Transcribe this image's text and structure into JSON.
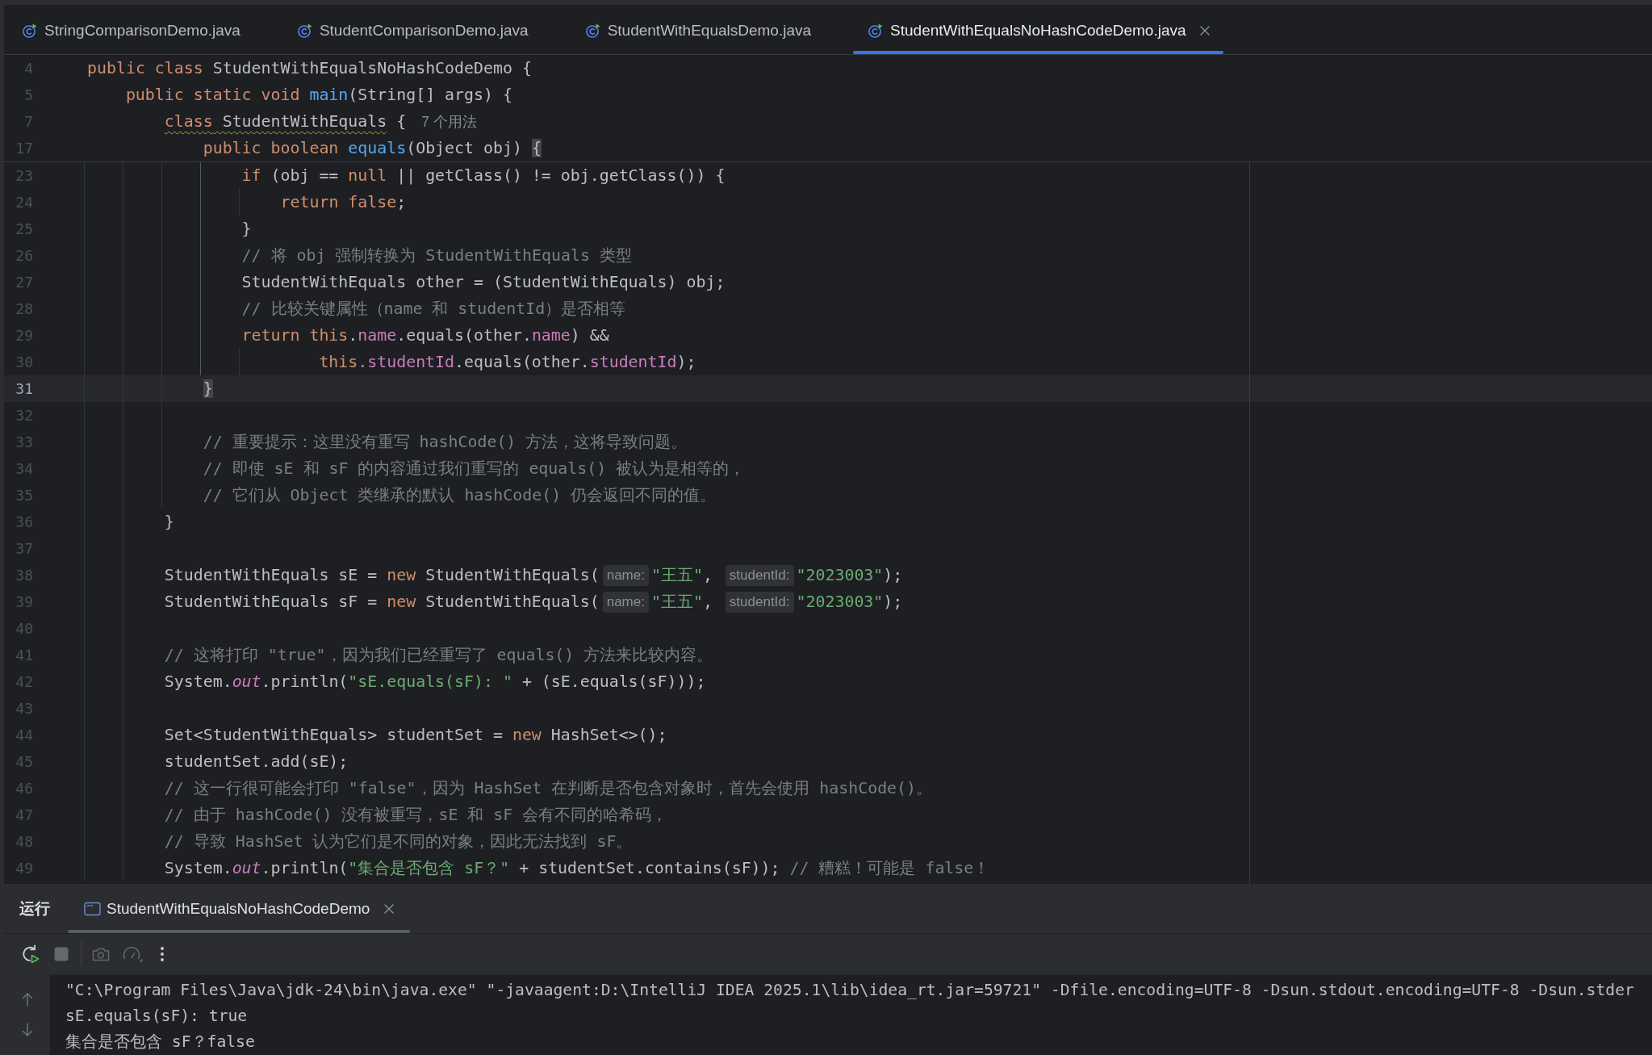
{
  "editor_tabs": [
    {
      "label": "StringComparisonDemo.java",
      "selected": false
    },
    {
      "label": "StudentComparisonDemo.java",
      "selected": false
    },
    {
      "label": "StudentWithEqualsDemo.java",
      "selected": false
    },
    {
      "label": "StudentWithEqualsNoHashCodeDemo.java",
      "selected": true
    }
  ],
  "editor": {
    "sticky_lines": [
      {
        "number": "4",
        "tokens": [
          {
            "kind": "keyword",
            "text": "public class"
          },
          {
            "kind": "plain",
            "text": " StudentWithEqualsNoHashCodeDemo {"
          }
        ]
      },
      {
        "number": "5",
        "tokens": [
          {
            "kind": "keyword",
            "text": "    public static void "
          },
          {
            "kind": "method",
            "text": "main"
          },
          {
            "kind": "plain",
            "text": "(String[] args) {"
          }
        ]
      },
      {
        "number": "7",
        "tokens": [
          {
            "kind": "warning",
            "tokens": [
              {
                "kind": "keyword",
                "text": "        class"
              },
              {
                "kind": "plain",
                "text": " StudentWithEquals"
              }
            ]
          },
          {
            "kind": "plain",
            "text": " {"
          },
          {
            "kind": "usage_hint",
            "text": "7 个用法"
          }
        ]
      },
      {
        "number": "17",
        "tokens": [
          {
            "kind": "keyword",
            "text": "            public boolean "
          },
          {
            "kind": "method",
            "text": "equals"
          },
          {
            "kind": "plain",
            "text": "(Object obj) "
          },
          {
            "kind": "brace_match",
            "text": "{"
          }
        ]
      }
    ],
    "lines": [
      {
        "number": "23",
        "current": false,
        "tokens": [
          {
            "kind": "keyword",
            "text": "                if"
          },
          {
            "kind": "plain",
            "text": " (obj == "
          },
          {
            "kind": "keyword",
            "text": "null"
          },
          {
            "kind": "plain",
            "text": " || getClass() != obj.getClass()) {"
          }
        ]
      },
      {
        "number": "24",
        "current": false,
        "tokens": [
          {
            "kind": "keyword",
            "text": "                    return false"
          },
          {
            "kind": "plain",
            "text": ";"
          }
        ]
      },
      {
        "number": "25",
        "current": false,
        "tokens": [
          {
            "kind": "plain",
            "text": "                }"
          }
        ]
      },
      {
        "number": "26",
        "current": false,
        "tokens": [
          {
            "kind": "comment",
            "text": "                // 将 obj 强制转换为 StudentWithEquals 类型"
          }
        ]
      },
      {
        "number": "27",
        "current": false,
        "tokens": [
          {
            "kind": "plain",
            "text": "                StudentWithEquals other = (StudentWithEquals) obj;"
          }
        ]
      },
      {
        "number": "28",
        "current": false,
        "tokens": [
          {
            "kind": "comment",
            "text": "                // 比较关键属性（name 和 studentId）是否相等"
          }
        ]
      },
      {
        "number": "29",
        "current": false,
        "tokens": [
          {
            "kind": "keyword",
            "text": "                return this"
          },
          {
            "kind": "plain",
            "text": "."
          },
          {
            "kind": "field",
            "text": "name"
          },
          {
            "kind": "plain",
            "text": ".equals(other."
          },
          {
            "kind": "field",
            "text": "name"
          },
          {
            "kind": "plain",
            "text": ") &&"
          }
        ]
      },
      {
        "number": "30",
        "current": false,
        "tokens": [
          {
            "kind": "keyword",
            "text": "                        this"
          },
          {
            "kind": "field",
            "text": ".studentId"
          },
          {
            "kind": "plain",
            "text": ".equals(other."
          },
          {
            "kind": "field",
            "text": "studentId"
          },
          {
            "kind": "plain",
            "text": ");"
          }
        ]
      },
      {
        "number": "31",
        "current": true,
        "tokens": [
          {
            "kind": "brace_match",
            "text": "            }"
          }
        ]
      },
      {
        "number": "32",
        "current": false
      },
      {
        "number": "33",
        "current": false,
        "tokens": [
          {
            "kind": "comment",
            "text": "            // 重要提示：这里没有重写 hashCode() 方法，这将导致问题。"
          }
        ]
      },
      {
        "number": "34",
        "current": false,
        "tokens": [
          {
            "kind": "comment",
            "text": "            // 即使 sE 和 sF 的内容通过我们重写的 equals() 被认为是相等的，"
          }
        ]
      },
      {
        "number": "35",
        "current": false,
        "tokens": [
          {
            "kind": "comment",
            "text": "            // 它们从 Object 类继承的默认 hashCode() 仍会返回不同的值。"
          }
        ]
      },
      {
        "number": "36",
        "current": false,
        "tokens": [
          {
            "kind": "plain",
            "text": "        }"
          }
        ]
      },
      {
        "number": "37",
        "current": false
      },
      {
        "number": "38",
        "current": false,
        "tokens": [
          {
            "kind": "plain",
            "text": "        StudentWithEquals sE = "
          },
          {
            "kind": "keyword",
            "text": "new"
          },
          {
            "kind": "plain",
            "text": " StudentWithEquals("
          },
          {
            "kind": "param_hint",
            "text": "name:"
          },
          {
            "kind": "string",
            "text": "\"王五\""
          },
          {
            "kind": "plain",
            "text": ", "
          },
          {
            "kind": "param_hint",
            "text": "studentId:"
          },
          {
            "kind": "string",
            "text": "\"2023003\""
          },
          {
            "kind": "plain",
            "text": ");"
          }
        ]
      },
      {
        "number": "39",
        "current": false,
        "tokens": [
          {
            "kind": "plain",
            "text": "        StudentWithEquals sF = "
          },
          {
            "kind": "keyword",
            "text": "new"
          },
          {
            "kind": "plain",
            "text": " StudentWithEquals("
          },
          {
            "kind": "param_hint",
            "text": "name:"
          },
          {
            "kind": "string",
            "text": "\"王五\""
          },
          {
            "kind": "plain",
            "text": ", "
          },
          {
            "kind": "param_hint",
            "text": "studentId:"
          },
          {
            "kind": "string",
            "text": "\"2023003\""
          },
          {
            "kind": "plain",
            "text": ");"
          }
        ]
      },
      {
        "number": "40",
        "current": false
      },
      {
        "number": "41",
        "current": false,
        "tokens": [
          {
            "kind": "comment",
            "text": "        // 这将打印 \"true\"，因为我们已经重写了 equals() 方法来比较内容。"
          }
        ]
      },
      {
        "number": "42",
        "current": false,
        "tokens": [
          {
            "kind": "plain",
            "text": "        System."
          },
          {
            "kind": "static_field",
            "text": "out"
          },
          {
            "kind": "plain",
            "text": ".println("
          },
          {
            "kind": "string",
            "text": "\"sE.equals(sF): \""
          },
          {
            "kind": "plain",
            "text": " + (sE.equals(sF)));"
          }
        ]
      },
      {
        "number": "43",
        "current": false
      },
      {
        "number": "44",
        "current": false,
        "tokens": [
          {
            "kind": "plain",
            "text": "        Set<StudentWithEquals> studentSet = "
          },
          {
            "kind": "keyword",
            "text": "new"
          },
          {
            "kind": "plain",
            "text": " HashSet<>();"
          }
        ]
      },
      {
        "number": "45",
        "current": false,
        "tokens": [
          {
            "kind": "plain",
            "text": "        studentSet.add(sE);"
          }
        ]
      },
      {
        "number": "46",
        "current": false,
        "tokens": [
          {
            "kind": "comment",
            "text": "        // 这一行很可能会打印 \"false\"，因为 HashSet 在判断是否包含对象时，首先会使用 hashCode()。"
          }
        ]
      },
      {
        "number": "47",
        "current": false,
        "tokens": [
          {
            "kind": "comment",
            "text": "        // 由于 hashCode() 没有被重写，sE 和 sF 会有不同的哈希码，"
          }
        ]
      },
      {
        "number": "48",
        "current": false,
        "tokens": [
          {
            "kind": "comment",
            "text": "        // 导致 HashSet 认为它们是不同的对象，因此无法找到 sF。"
          }
        ]
      },
      {
        "number": "49",
        "current": false,
        "tokens": [
          {
            "kind": "plain",
            "text": "        System."
          },
          {
            "kind": "static_field",
            "text": "out"
          },
          {
            "kind": "plain",
            "text": ".println("
          },
          {
            "kind": "string",
            "text": "\"集合是否包含 sF？\""
          },
          {
            "kind": "plain",
            "text": " + studentSet.contains(sF)); "
          },
          {
            "kind": "comment",
            "text": "// 糟糕！可能是 false！"
          }
        ]
      }
    ]
  },
  "run_panel": {
    "title": "运行",
    "tabs": [
      {
        "label": "StudentWithEqualsNoHashCodeDemo",
        "selected": true
      }
    ],
    "toolbar": {
      "rerun": {
        "disabled": false
      },
      "stop": {
        "disabled": true
      },
      "screenshot": {
        "disabled": true
      },
      "profiler": {
        "disabled": true
      },
      "more": {
        "disabled": false
      }
    },
    "console_lines": [
      "\"C:\\Program Files\\Java\\jdk-24\\bin\\java.exe\" \"-javaagent:D:\\IntelliJ IDEA 2025.1\\lib\\idea_rt.jar=59721\" -Dfile.encoding=UTF-8 -Dsun.stdout.encoding=UTF-8 -Dsun.stder",
      "sE.equals(sF): true",
      "集合是否包含 sF？false"
    ]
  }
}
